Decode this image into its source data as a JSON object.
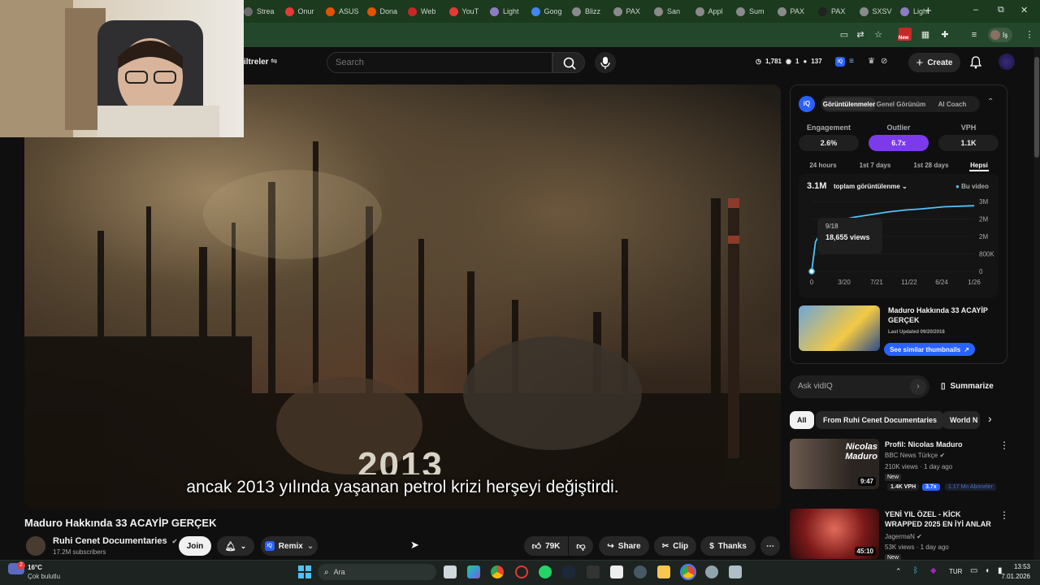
{
  "browser": {
    "tabs": [
      {
        "label": "Strea",
        "color": "#6b6b6b"
      },
      {
        "label": "Onur",
        "color": "#e53935"
      },
      {
        "label": "ASUS",
        "color": "#e65100"
      },
      {
        "label": "Dona",
        "color": "#e65100"
      },
      {
        "label": "Web",
        "color": "#c62828"
      },
      {
        "label": "YouT",
        "color": "#e53935"
      },
      {
        "label": "Light",
        "color": "#8e7cc3"
      },
      {
        "label": "Goog",
        "color": "#4285f4"
      },
      {
        "label": "Blizz",
        "color": "#8a8a8a"
      },
      {
        "label": "PAX",
        "color": "#8a8a8a"
      },
      {
        "label": "San",
        "color": "#8a8a8a"
      },
      {
        "label": "Appl",
        "color": "#8a8a8a"
      },
      {
        "label": "Sum",
        "color": "#8a8a8a"
      },
      {
        "label": "PAX",
        "color": "#8a8a8a"
      },
      {
        "label": "PAX",
        "color": "#222222"
      },
      {
        "label": "SXSV",
        "color": "#8a8a8a"
      },
      {
        "label": "Light",
        "color": "#8e7cc3"
      }
    ],
    "new_tab": "+",
    "window_controls": [
      "–",
      "⧉",
      "✕"
    ],
    "new_badge": "New",
    "profile_label": "İş"
  },
  "header": {
    "filters_label": "iltreler",
    "search_placeholder": "Search",
    "stats": {
      "watch": "1,781",
      "eye": "1",
      "subs": "137"
    },
    "create_label": "Create"
  },
  "video": {
    "title": "Maduro Hakkında 33 ACAYİP GERÇEK",
    "subtitle": "ancak 2013 yılında yaşanan petrol krizi herşeyi değiştirdi.",
    "overlay_year": "2013",
    "channel": "Ruhi Cenet Documentaries",
    "subscribers": "17.2M subscribers",
    "join": "Join",
    "remix": "Remix",
    "likes": "79K",
    "share": "Share",
    "clip": "Clip",
    "thanks": "Thanks"
  },
  "vidiq": {
    "tabs": [
      "Görüntülenmeler",
      "Genel Görünüm",
      "AI Coach"
    ],
    "active_tab": 0,
    "stat_labels": [
      "Engagement",
      "Outlier",
      "VPH"
    ],
    "stat_values": [
      "2.6%",
      "6.7x",
      "1.1K"
    ],
    "ranges": [
      "24 hours",
      "1st 7 days",
      "1st 28 days",
      "Hepsi"
    ],
    "active_range": 3,
    "total": "3.1M",
    "metric_dropdown": "toplam görüntülenme",
    "legend": "Bu video",
    "tooltip_date": "9/18",
    "tooltip_value": "18,655 views",
    "card_title": "Maduro Hakkında 33 ACAYİP GERÇEK",
    "card_updated": "Last Updated 09/20/2018",
    "similar_button": "See similar thumbnails",
    "ask_placeholder": "Ask vidIQ",
    "summarize": "Summarize",
    "accent": "#7c3aed",
    "brand": "#2962ff"
  },
  "chart_data": {
    "type": "line",
    "x_tick_labels": [
      "0",
      "3/20",
      "7/21",
      "11/22",
      "6/24",
      "1/26"
    ],
    "y_tick_labels": [
      "3M",
      "2M",
      "2M",
      "800K",
      "0"
    ],
    "series": [
      {
        "name": "Bu video",
        "points": [
          [
            0,
            0
          ],
          [
            0.2,
            1.4
          ],
          [
            0.6,
            2.0
          ],
          [
            1.2,
            2.35
          ],
          [
            2.2,
            2.55
          ],
          [
            4,
            2.8
          ],
          [
            5,
            2.9
          ],
          [
            5.8,
            2.95
          ],
          [
            7,
            3.05
          ],
          [
            8.6,
            3.1
          ]
        ]
      }
    ],
    "x_range": [
      0,
      8.6
    ],
    "y_range": [
      0,
      3.3
    ],
    "highlight_point": [
      0,
      0
    ]
  },
  "chips": [
    "All",
    "From Ruhi Cenet Documentaries",
    "World N"
  ],
  "related": [
    {
      "title": "Profil: Nicolas Maduro",
      "channel": "BBC News Türkçe",
      "meta": "210K views · 1 day ago",
      "badge": "New",
      "vph": "1.4K VPH",
      "outlier": "3.7x",
      "subs": "1.17 Mn Aboneler",
      "duration": "9:47",
      "thumb_text": "Nicolas Maduro"
    },
    {
      "title": "YENİ YIL ÖZEL - KİCK WRAPPED 2025 EN İYİ ANLAR",
      "channel": "JagermaN",
      "meta": "53K views · 1 day ago",
      "badge": "New",
      "duration": "45:10"
    }
  ],
  "taskbar": {
    "weather_temp": "16°C",
    "weather_desc": "Çok bulutlu",
    "weather_badge": "2",
    "search_placeholder": "Ara",
    "language": "TUR",
    "time": "13:53",
    "date": "7.01.2026"
  }
}
